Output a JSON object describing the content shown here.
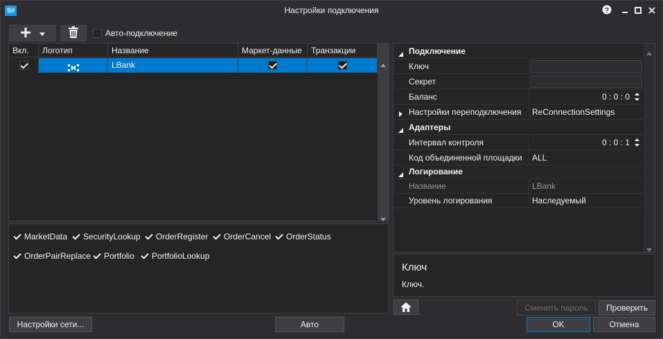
{
  "window": {
    "title": "Настройки подключения",
    "app_icon_text": "S#",
    "help_icon": "help-icon",
    "minimize_icon": "minimize-icon",
    "maximize_icon": "maximize-icon",
    "close_icon": "close-icon"
  },
  "toolbar": {
    "add_icon": "plus-icon",
    "dropdown_icon": "chevron-down-icon",
    "delete_icon": "trash-icon",
    "auto_connect_label": "Авто-подключение",
    "auto_connect_checked": false
  },
  "grid": {
    "columns": [
      "Вкл.",
      "Логотип",
      "Название",
      "Маркет-данные",
      "Транзакции"
    ],
    "rows": [
      {
        "enabled": true,
        "logo": "LBank-logo",
        "name": "LBank",
        "market_data": true,
        "transactions": true
      }
    ]
  },
  "messages": [
    {
      "label": "MarketData",
      "checked": true
    },
    {
      "label": "SecurityLookup",
      "checked": true
    },
    {
      "label": "OrderRegister",
      "checked": true
    },
    {
      "label": "OrderCancel",
      "checked": true
    },
    {
      "label": "OrderStatus",
      "checked": true
    },
    {
      "label": "OrderPairReplace",
      "checked": true
    },
    {
      "label": "Portfolio",
      "checked": true
    },
    {
      "label": "PortfolioLookup",
      "checked": true
    }
  ],
  "properties": {
    "cat_connection": "Подключение",
    "key_label": "Ключ",
    "key_value": "",
    "secret_label": "Секрет",
    "secret_value": "",
    "balance_label": "Баланс",
    "balance_value": "0 : 0 : 0",
    "reconnect_label": "Настройки переподключения",
    "reconnect_value": "ReConnectionSettings",
    "cat_adapters": "Адаптеры",
    "interval_label": "Интервал контроля",
    "interval_value": "0 : 0 : 1",
    "board_code_label": "Код объединенной площадки",
    "board_code_value": "ALL",
    "cat_logging": "Логирование",
    "name_label": "Название",
    "name_value": "LBank",
    "log_level_label": "Уровень логирования",
    "log_level_value": "Наследуемый"
  },
  "description": {
    "title": "Ключ",
    "text": "Ключ."
  },
  "buttons": {
    "home_icon": "home-icon",
    "change_password": "Сменить пароль",
    "check": "Проверить",
    "network_settings": "Настройки сети...",
    "auto": "Авто",
    "ok": "OK",
    "cancel": "Отмена"
  },
  "colors": {
    "selection": "#007acc",
    "accent": "#1c97ea"
  }
}
